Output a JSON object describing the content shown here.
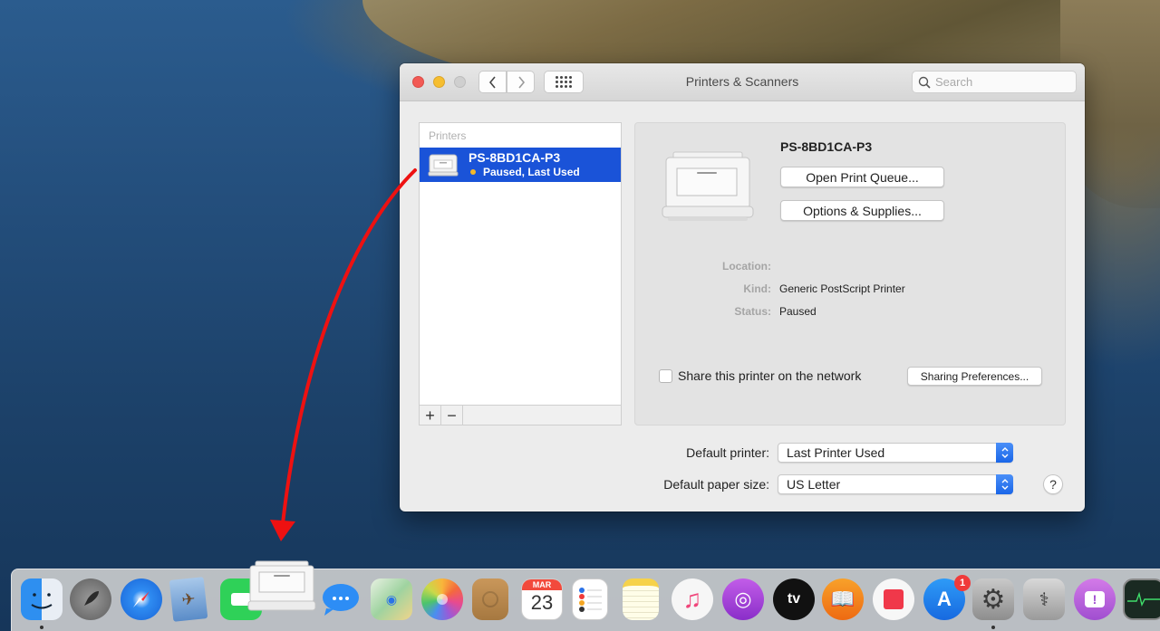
{
  "window": {
    "title": "Printers & Scanners",
    "search_placeholder": "Search",
    "toolbar": {
      "back_glyph": "‹",
      "forward_glyph": "›"
    }
  },
  "printers_list": {
    "header": "Printers",
    "items": [
      {
        "name": "PS-8BD1CA-P3",
        "status": "Paused, Last Used",
        "status_color": "#f5b829",
        "selected": true
      }
    ],
    "add_label": "+",
    "remove_label": "−"
  },
  "detail": {
    "printer_name": "PS-8BD1CA-P3",
    "open_queue_label": "Open Print Queue...",
    "options_label": "Options & Supplies...",
    "fields": [
      {
        "label": "Location:",
        "value": ""
      },
      {
        "label": "Kind:",
        "value": "Generic PostScript Printer"
      },
      {
        "label": "Status:",
        "value": "Paused"
      }
    ],
    "share_label": "Share this printer on the network",
    "share_checked": false,
    "sharing_prefs_label": "Sharing Preferences..."
  },
  "defaults": {
    "printer_label": "Default printer:",
    "printer_value": "Last Printer Used",
    "paper_label": "Default paper size:",
    "paper_value": "US Letter",
    "help_label": "?"
  },
  "dock": {
    "items": [
      {
        "name": "Finder",
        "running": true
      },
      {
        "name": "Launchpad"
      },
      {
        "name": "Safari"
      },
      {
        "name": "Mail"
      },
      {
        "name": "FaceTime"
      },
      {
        "name": "Messages"
      },
      {
        "name": "Maps"
      },
      {
        "name": "Photos"
      },
      {
        "name": "Contacts"
      },
      {
        "name": "Calendar",
        "month": "MAR",
        "day": "23"
      },
      {
        "name": "Reminders"
      },
      {
        "name": "Notes"
      },
      {
        "name": "Music"
      },
      {
        "name": "Podcasts"
      },
      {
        "name": "TV",
        "label": "tv"
      },
      {
        "name": "Books"
      },
      {
        "name": "News"
      },
      {
        "name": "App Store",
        "badge": "1"
      },
      {
        "name": "System Preferences",
        "running": true
      },
      {
        "name": "Disk Utility"
      },
      {
        "name": "Feedback Assistant",
        "label": "!"
      },
      {
        "name": "Activity Monitor"
      }
    ]
  },
  "annotation": {
    "arrow_color": "#ee1111"
  },
  "colors": {
    "selection_blue": "#1a53d8",
    "select_arrow_blue": "#2a72ee"
  }
}
